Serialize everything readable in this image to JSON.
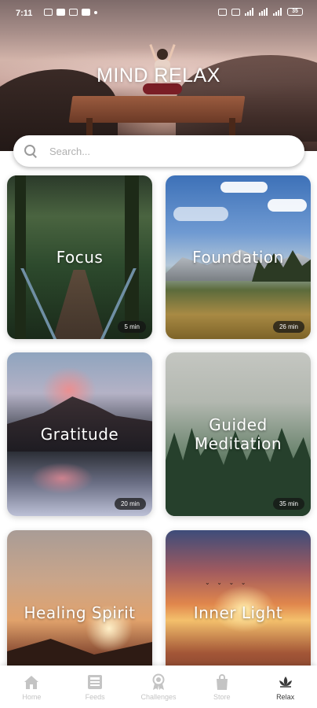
{
  "status_bar": {
    "time": "7:11",
    "battery": "35"
  },
  "header": {
    "title": "MIND RELAX"
  },
  "search": {
    "placeholder": "Search..."
  },
  "cards": [
    {
      "title": "Focus",
      "duration": "5 min"
    },
    {
      "title": "Foundation",
      "duration": "26 min"
    },
    {
      "title": "Gratitude",
      "duration": "20 min"
    },
    {
      "title": "Guided\nMeditation",
      "duration": "35 min"
    },
    {
      "title": "Healing Spirit"
    },
    {
      "title": "Inner Light"
    }
  ],
  "bottom_nav": {
    "items": [
      {
        "label": "Home",
        "icon": "home-icon"
      },
      {
        "label": "Feeds",
        "icon": "feeds-icon"
      },
      {
        "label": "Challenges",
        "icon": "award-icon"
      },
      {
        "label": "Store",
        "icon": "shopping-bag-icon"
      },
      {
        "label": "Relax",
        "icon": "lotus-icon"
      }
    ],
    "active": "Relax",
    "active_color": "#3a3a3a",
    "inactive_color": "#c4c4c4"
  }
}
